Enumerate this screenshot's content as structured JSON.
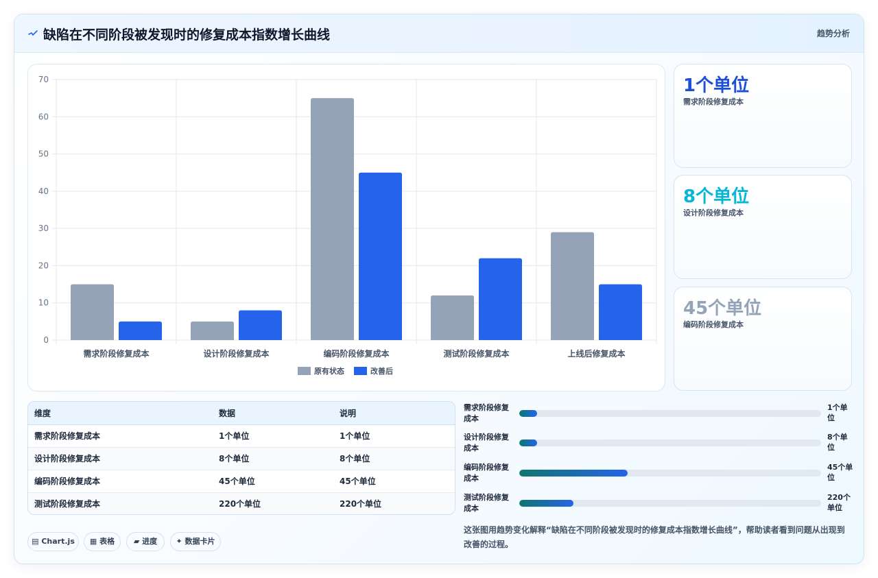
{
  "header": {
    "title": "缺陷在不同阶段被发现时的修复成本指数增长曲线",
    "tag": "趋势分析"
  },
  "chart_data": {
    "type": "bar",
    "categories": [
      "需求阶段修复成本",
      "设计阶段修复成本",
      "编码阶段修复成本",
      "测试阶段修复成本",
      "上线后修复成本"
    ],
    "series": [
      {
        "name": "原有状态",
        "values": [
          15,
          5,
          65,
          12,
          29
        ],
        "color": "#94a3b8"
      },
      {
        "name": "改善后",
        "values": [
          5,
          8,
          45,
          22,
          15
        ],
        "color": "#2563eb"
      }
    ],
    "ylim": [
      0,
      70
    ],
    "yticks": [
      0,
      10,
      20,
      30,
      40,
      50,
      60,
      70
    ],
    "grid": true,
    "legend": "bottom"
  },
  "stats": [
    {
      "value": "1个单位",
      "label": "需求阶段修复成本",
      "color": "#1d4ed8"
    },
    {
      "value": "8个单位",
      "label": "设计阶段修复成本",
      "color": "#06b6d4"
    },
    {
      "value": "45个单位",
      "label": "编码阶段修复成本",
      "color": "#94a3b8"
    }
  ],
  "table": {
    "headers": [
      "维度",
      "数据",
      "说明"
    ],
    "rows": [
      [
        "需求阶段修复成本",
        "1个单位",
        "1个单位"
      ],
      [
        "设计阶段修复成本",
        "8个单位",
        "8个单位"
      ],
      [
        "编码阶段修复成本",
        "45个单位",
        "45个单位"
      ],
      [
        "测试阶段修复成本",
        "220个单位",
        "220个单位"
      ]
    ]
  },
  "progress": [
    {
      "label": "需求阶段修复成本",
      "value": "1个单位",
      "percent": 6
    },
    {
      "label": "设计阶段修复成本",
      "value": "8个单位",
      "percent": 6
    },
    {
      "label": "编码阶段修复成本",
      "value": "45个单位",
      "percent": 36
    },
    {
      "label": "测试阶段修复成本",
      "value": "220个单位",
      "percent": 18
    }
  ],
  "chips": [
    {
      "icon": "▤",
      "label": "Chart.js"
    },
    {
      "icon": "▦",
      "label": "表格"
    },
    {
      "icon": "▰",
      "label": "进度"
    },
    {
      "icon": "✦",
      "label": "数据卡片"
    }
  ],
  "note": "这张图用趋势变化解释“缺陷在不同阶段被发现时的修复成本指数增长曲线”，帮助读者看到问题从出现到改善的过程。"
}
